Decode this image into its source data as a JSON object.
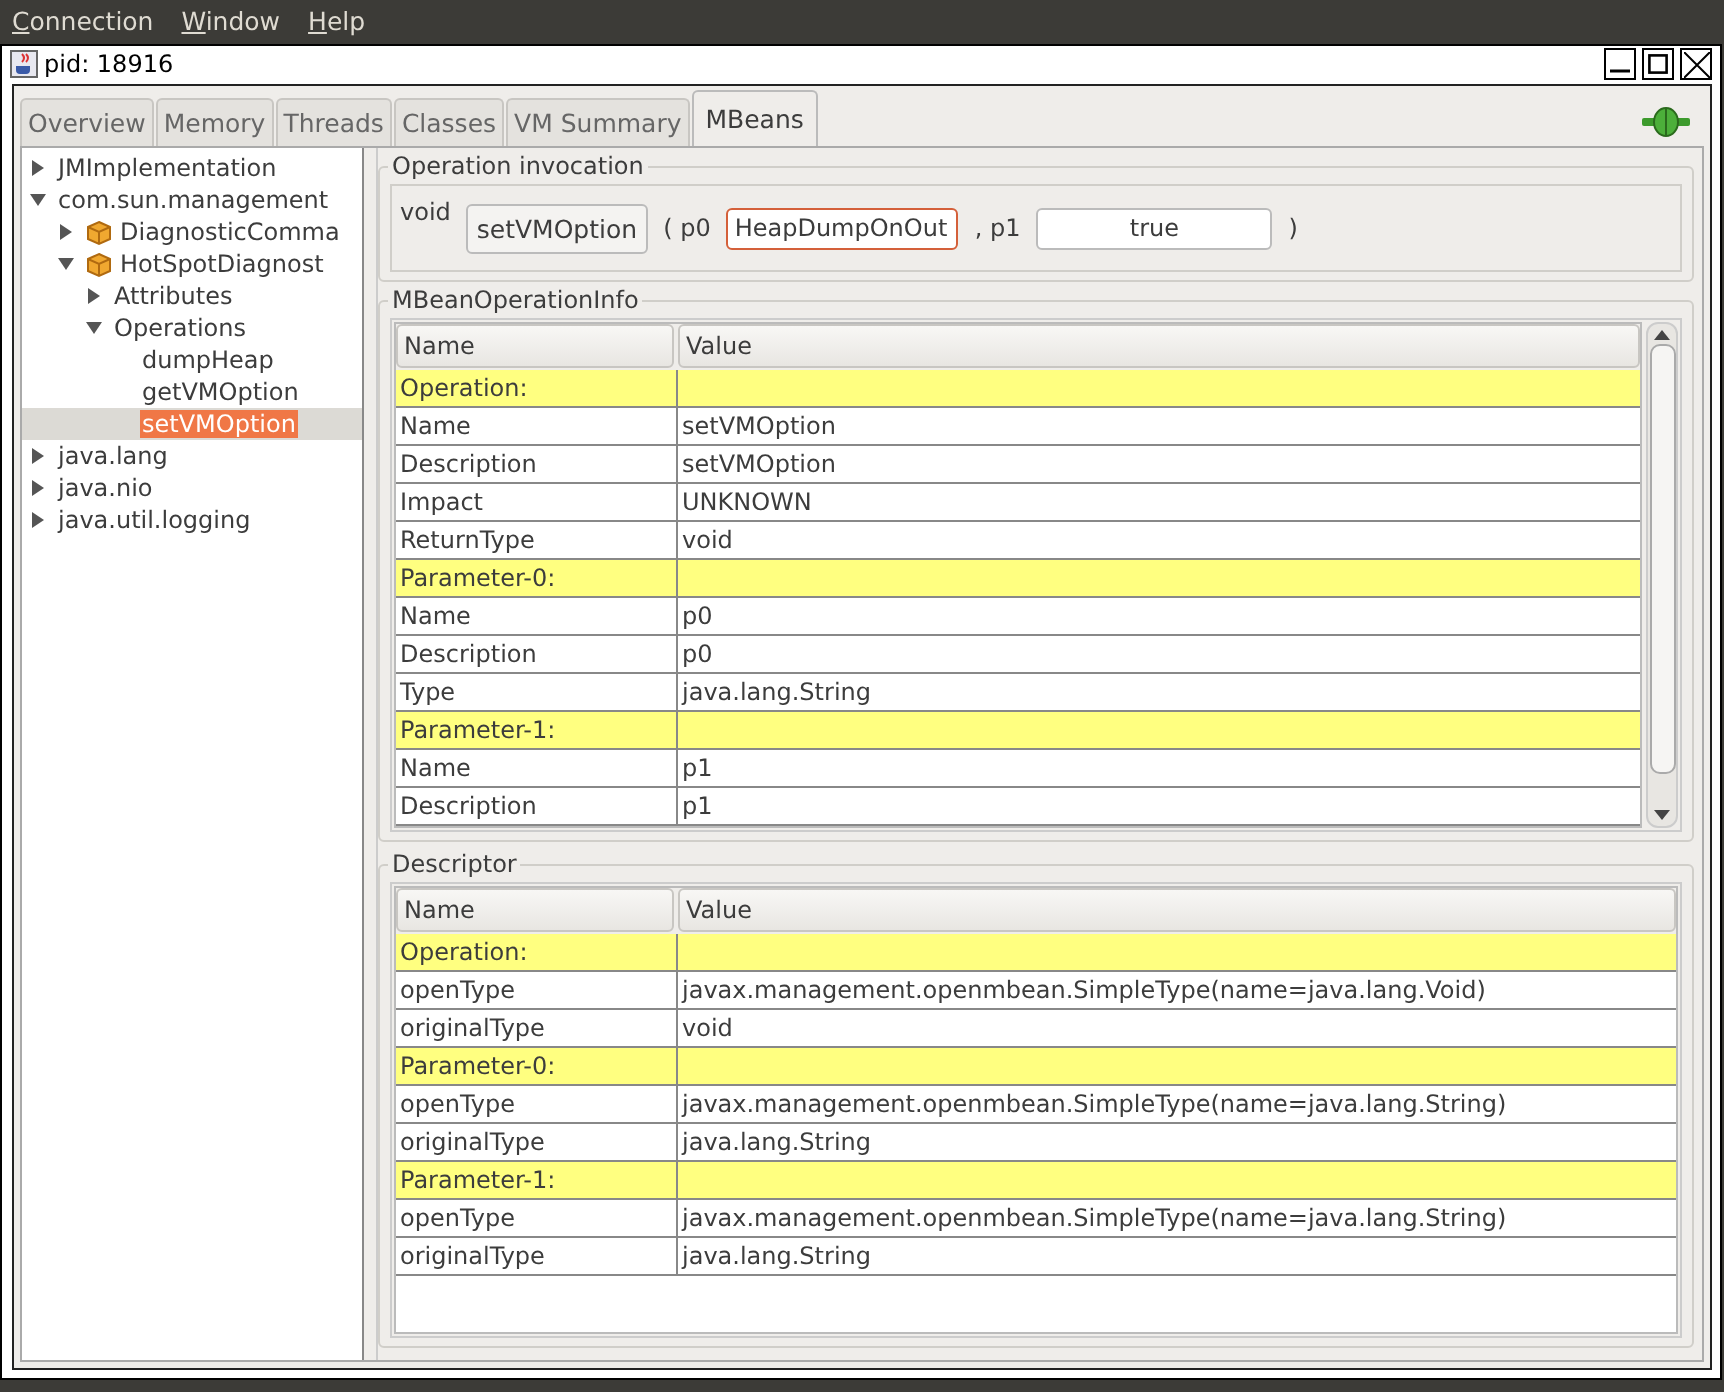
{
  "menu": [
    "Connection",
    "Window",
    "Help"
  ],
  "window": {
    "title": "pid: 18916"
  },
  "tabs": [
    {
      "label": "Overview",
      "selected": false
    },
    {
      "label": "Memory",
      "selected": false
    },
    {
      "label": "Threads",
      "selected": false
    },
    {
      "label": "Classes",
      "selected": false
    },
    {
      "label": "VM Summary",
      "selected": false
    },
    {
      "label": "MBeans",
      "selected": true
    }
  ],
  "tree": [
    {
      "label": "JMImplementation",
      "expanded": false,
      "selected": false
    },
    {
      "label": "com.sun.management",
      "expanded": true,
      "selected": false,
      "children": [
        {
          "label": "DiagnosticComma",
          "kind": "mbean",
          "expanded": false,
          "selected": false
        },
        {
          "label": "HotSpotDiagnost",
          "kind": "mbean",
          "expanded": true,
          "selected": false,
          "children": [
            {
              "label": "Attributes",
              "expanded": false,
              "selected": false
            },
            {
              "label": "Operations",
              "expanded": true,
              "selected": false,
              "children": [
                {
                  "label": "dumpHeap",
                  "selected": false
                },
                {
                  "label": "getVMOption",
                  "selected": false
                },
                {
                  "label": "setVMOption",
                  "selected": true
                }
              ]
            }
          ]
        }
      ]
    },
    {
      "label": "java.lang",
      "expanded": false,
      "selected": false
    },
    {
      "label": "java.nio",
      "expanded": false,
      "selected": false
    },
    {
      "label": "java.util.logging",
      "expanded": false,
      "selected": false
    }
  ],
  "invocation": {
    "title": "Operation invocation",
    "return_type": "void",
    "button": "setVMOption",
    "open_paren": "( p0",
    "params": [
      {
        "kind": "text",
        "value": "HeapDumpOnOut",
        "focused": true,
        "separator": ", p1"
      },
      {
        "kind": "boolean",
        "value": "true",
        "focused": false,
        "separator": ")"
      }
    ]
  },
  "operation_info": {
    "title": "MBeanOperationInfo",
    "columns": [
      "Name",
      "Value"
    ],
    "rows": [
      {
        "kind": "section",
        "name": "Operation:"
      },
      {
        "kind": "field",
        "name": "Name",
        "value": "setVMOption"
      },
      {
        "kind": "field",
        "name": "Description",
        "value": "setVMOption"
      },
      {
        "kind": "field",
        "name": "Impact",
        "value": "UNKNOWN"
      },
      {
        "kind": "field",
        "name": "ReturnType",
        "value": "void"
      },
      {
        "kind": "section",
        "name": "Parameter-0:"
      },
      {
        "kind": "field",
        "name": "Name",
        "value": "p0"
      },
      {
        "kind": "field",
        "name": "Description",
        "value": "p0"
      },
      {
        "kind": "field",
        "name": "Type",
        "value": "java.lang.String"
      },
      {
        "kind": "section",
        "name": "Parameter-1:"
      },
      {
        "kind": "field",
        "name": "Name",
        "value": "p1"
      },
      {
        "kind": "field",
        "name": "Description",
        "value": "p1"
      }
    ]
  },
  "descriptor": {
    "title": "Descriptor",
    "columns": [
      "Name",
      "Value"
    ],
    "rows": [
      {
        "kind": "section",
        "name": "Operation:"
      },
      {
        "kind": "field",
        "name": "openType",
        "value": "javax.management.openmbean.SimpleType(name=java.lang.Void)"
      },
      {
        "kind": "field",
        "name": "originalType",
        "value": "void"
      },
      {
        "kind": "section",
        "name": "Parameter-0:"
      },
      {
        "kind": "field",
        "name": "openType",
        "value": "javax.management.openmbean.SimpleType(name=java.lang.String)"
      },
      {
        "kind": "field",
        "name": "originalType",
        "value": "java.lang.String"
      },
      {
        "kind": "section",
        "name": "Parameter-1:"
      },
      {
        "kind": "field",
        "name": "openType",
        "value": "javax.management.openmbean.SimpleType(name=java.lang.String)"
      },
      {
        "kind": "field",
        "name": "originalType",
        "value": "java.lang.String"
      }
    ]
  }
}
